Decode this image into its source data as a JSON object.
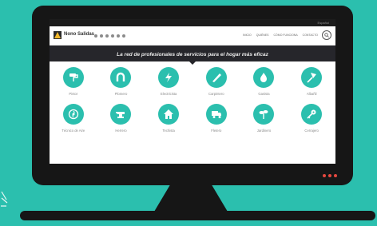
{
  "colors": {
    "background": "#2bbfae",
    "accent": "#2bbfae",
    "monitor": "#161616",
    "banner": "#26262b",
    "dots": "#e5483f"
  },
  "topbar": {
    "language": "Español"
  },
  "navbar": {
    "logo_text": "Nono Salidas",
    "links": [
      "INICIO",
      "QUIÉNES",
      "CÓMO FUNCIONA",
      "CONTACTO"
    ]
  },
  "banner": {
    "tagline": "La red de profesionales de servicios para el hogar más eficaz"
  },
  "services": [
    {
      "label": "Pintor",
      "icon": "paint-roller-icon"
    },
    {
      "label": "Plomero",
      "icon": "magnet-icon"
    },
    {
      "label": "Electricista",
      "icon": "lightning-icon"
    },
    {
      "label": "Carpintero",
      "icon": "saw-icon"
    },
    {
      "label": "Gasista",
      "icon": "flame-icon"
    },
    {
      "label": "Albañil",
      "icon": "trowel-icon"
    },
    {
      "label": "Técnico de Aire",
      "icon": "fan-icon"
    },
    {
      "label": "Herrero",
      "icon": "anvil-icon"
    },
    {
      "label": "Techista",
      "icon": "house-icon"
    },
    {
      "label": "Fletero",
      "icon": "truck-icon"
    },
    {
      "label": "Jardinero",
      "icon": "plant-icon"
    },
    {
      "label": "Cerrajero",
      "icon": "key-icon"
    }
  ]
}
